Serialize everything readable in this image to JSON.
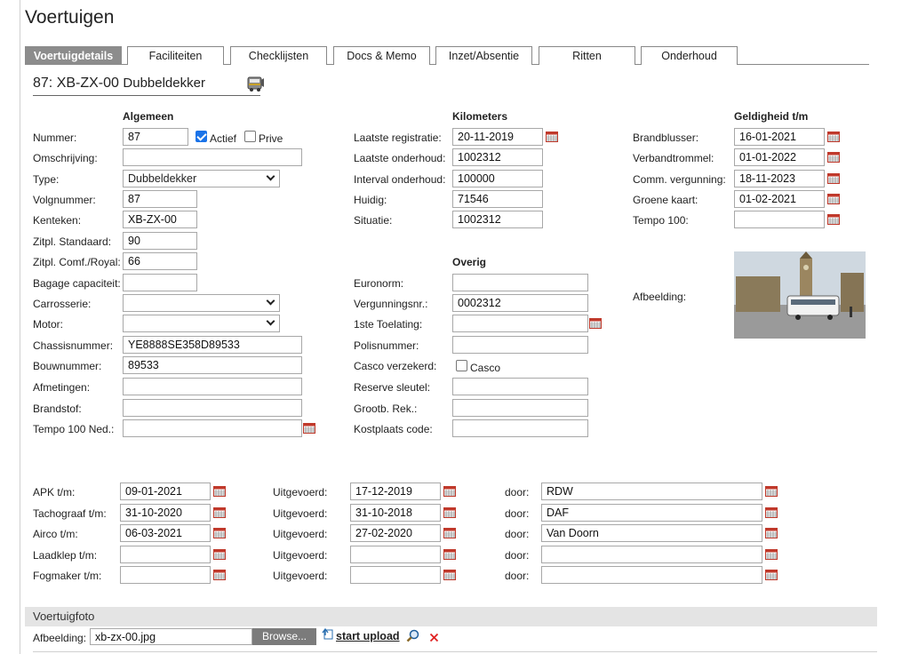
{
  "page_title": "Voertuigen",
  "tabs": [
    {
      "label": "Voertuigdetails",
      "active": true
    },
    {
      "label": "Faciliteiten"
    },
    {
      "label": "Checklijsten"
    },
    {
      "label": "Docs & Memo"
    },
    {
      "label": "Inzet/Absentie"
    },
    {
      "label": "Ritten"
    },
    {
      "label": "Onderhoud"
    }
  ],
  "vehicle": {
    "id_plate": "87: XB-ZX-00",
    "type": "Dubbeldekker"
  },
  "sections": {
    "general": "Algemeen",
    "kilometers": "Kilometers",
    "validity": "Geldigheid t/m",
    "other": "Overig"
  },
  "general": {
    "nummer_label": "Nummer:",
    "nummer": "87",
    "actief_label": "Actief",
    "actief_checked": true,
    "prive_label": "Prive",
    "prive_checked": false,
    "omschrijving_label": "Omschrijving:",
    "omschrijving": "",
    "type_label": "Type:",
    "type": "Dubbeldekker",
    "volgnummer_label": "Volgnummer:",
    "volgnummer": "87",
    "kenteken_label": "Kenteken:",
    "kenteken": "XB-ZX-00",
    "zitpl_std_label": "Zitpl. Standaard:",
    "zitpl_std": "90",
    "zitpl_comf_label": "Zitpl. Comf./Royal:",
    "zitpl_comf": "66",
    "bagage_label": "Bagage capaciteit:",
    "bagage": "",
    "carrosserie_label": "Carrosserie:",
    "carrosserie": "",
    "motor_label": "Motor:",
    "motor": "",
    "chassis_label": "Chassisnummer:",
    "chassis": "YE8888SE358D89533",
    "bouwnummer_label": "Bouwnummer:",
    "bouwnummer": "89533",
    "afmetingen_label": "Afmetingen:",
    "afmetingen": "",
    "brandstof_label": "Brandstof:",
    "brandstof": "",
    "tempo_label": "Tempo 100 Ned.:",
    "tempo": ""
  },
  "kilometers": {
    "laatste_reg_label": "Laatste registratie:",
    "laatste_reg": "20-11-2019",
    "laatste_ond_label": "Laatste onderhoud:",
    "laatste_ond": "1002312",
    "interval_label": "Interval onderhoud:",
    "interval": "100000",
    "huidig_label": "Huidig:",
    "huidig": "71546",
    "situatie_label": "Situatie:",
    "situatie": "1002312"
  },
  "validity": {
    "brandblusser_label": "Brandblusser:",
    "brandblusser": "16-01-2021",
    "verbandtrommel_label": "Verbandtrommel:",
    "verbandtrommel": "01-01-2022",
    "comm_label": "Comm. vergunning:",
    "comm": "18-11-2023",
    "groene_label": "Groene kaart:",
    "groene": "01-02-2021",
    "tempo_label": "Tempo 100:",
    "tempo": "",
    "afbeelding_label": "Afbeelding:"
  },
  "other": {
    "euronorm_label": "Euronorm:",
    "euronorm": "",
    "vergunning_label": "Vergunningsnr.:",
    "vergunning": "0002312",
    "toelating_label": "1ste Toelating:",
    "toelating": "",
    "polis_label": "Polisnummer:",
    "polis": "",
    "casco_label": "Casco verzekerd:",
    "casco_check_label": "Casco",
    "casco_checked": false,
    "reserve_label": "Reserve sleutel:",
    "reserve": "",
    "grootb_label": "Grootb. Rek.:",
    "grootb": "",
    "kostplaats_label": "Kostplaats code:",
    "kostplaats": ""
  },
  "inspections": {
    "uitgevoerd_label": "Uitgevoerd:",
    "door_label": "door:",
    "rows": [
      {
        "label": "APK t/m:",
        "date": "09-01-2021",
        "uitgevoerd": "17-12-2019",
        "door": "RDW"
      },
      {
        "label": "Tachograaf t/m:",
        "date": "31-10-2020",
        "uitgevoerd": "31-10-2018",
        "door": "DAF"
      },
      {
        "label": "Airco t/m:",
        "date": "06-03-2021",
        "uitgevoerd": "27-02-2020",
        "door": "Van Doorn"
      },
      {
        "label": "Laadklep t/m:",
        "date": "",
        "uitgevoerd": "",
        "door": ""
      },
      {
        "label": "Fogmaker t/m:",
        "date": "",
        "uitgevoerd": "",
        "door": ""
      }
    ]
  },
  "photo_section": {
    "title": "Voertuigfoto",
    "afbeelding_label": "Afbeelding:",
    "filename": "xb-zx-00.jpg",
    "browse_label": "Browse...",
    "upload_label": "start upload"
  },
  "colors": {
    "active_tab": "#8c8c8c",
    "calendar": "#c0392b",
    "delete_icon": "#e02020",
    "checkbox": "#1a73e8"
  }
}
